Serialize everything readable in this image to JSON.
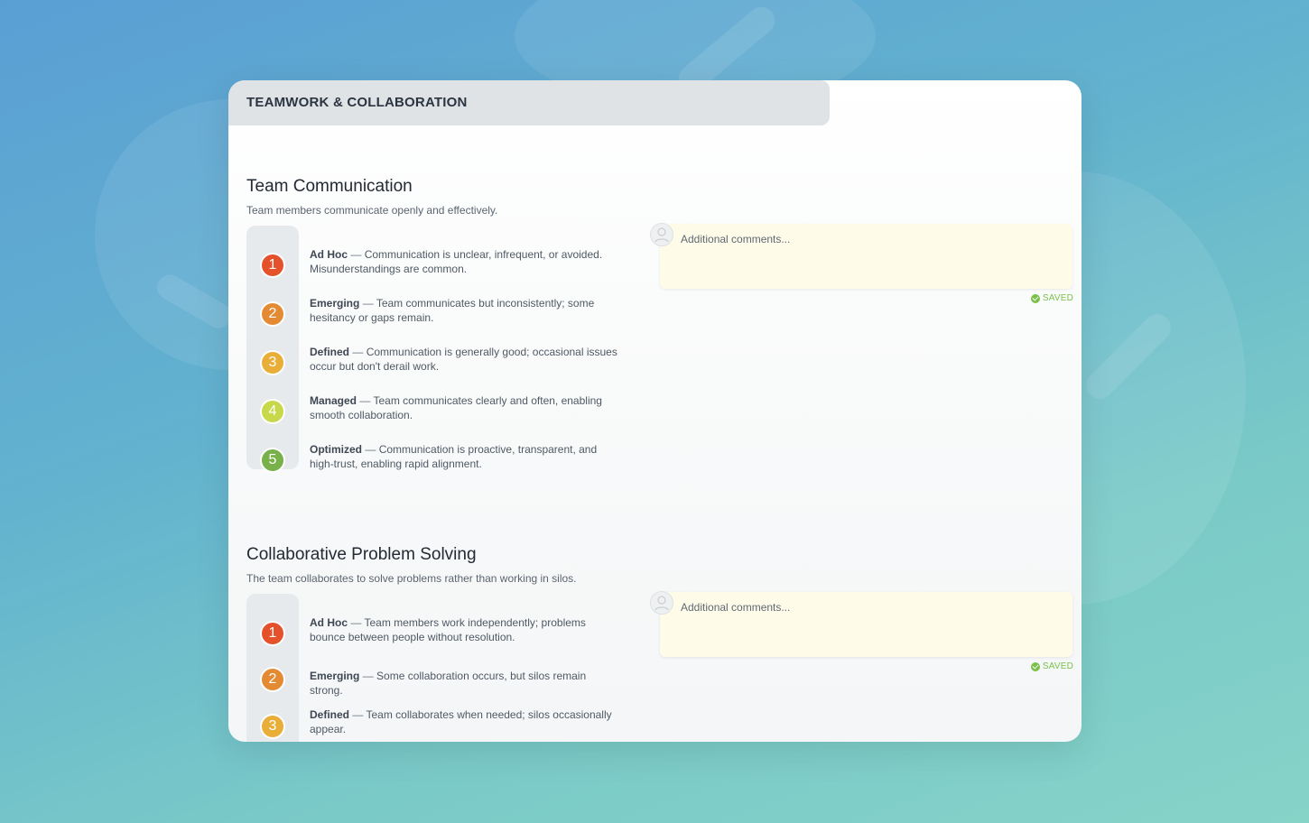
{
  "header": {
    "title": "TEAMWORK & COLLABORATION"
  },
  "colors": {
    "level1": "#e4512b",
    "level2": "#e48a33",
    "level3": "#e8ae38",
    "level4": "#c7d84a",
    "level5": "#78b04a",
    "saved": "#7cc04a",
    "comment_bg": "#fefce9"
  },
  "sections": [
    {
      "title": "Team Communication",
      "subtitle": "Team members communicate openly and effectively.",
      "levels": [
        {
          "number": "1",
          "name": "Ad Hoc",
          "description": "Communication is unclear, infrequent, or avoided. Misunderstandings are common."
        },
        {
          "number": "2",
          "name": "Emerging",
          "description": "Team communicates but inconsistently; some hesitancy or gaps remain."
        },
        {
          "number": "3",
          "name": "Defined",
          "description": "Communication is generally good; occasional issues occur but don't derail work."
        },
        {
          "number": "4",
          "name": "Managed",
          "description": "Team communicates clearly and often, enabling smooth collaboration."
        },
        {
          "number": "5",
          "name": "Optimized",
          "description": "Communication is proactive, transparent, and high-trust, enabling rapid alignment."
        }
      ],
      "comment_placeholder": "Additional comments...",
      "status": "SAVED"
    },
    {
      "title": "Collaborative Problem Solving",
      "subtitle": "The team collaborates to solve problems rather than working in silos.",
      "levels": [
        {
          "number": "1",
          "name": "Ad Hoc",
          "description": "Team members work independently; problems bounce between people without resolution."
        },
        {
          "number": "2",
          "name": "Emerging",
          "description": "Some collaboration occurs, but silos remain strong."
        },
        {
          "number": "3",
          "name": "Defined",
          "description": "Team collaborates when needed; silos occasionally appear."
        }
      ],
      "comment_placeholder": "Additional comments...",
      "status": "SAVED"
    }
  ]
}
